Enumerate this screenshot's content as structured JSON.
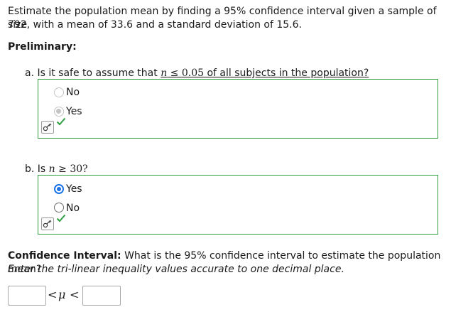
{
  "problem": {
    "statement_line1": "Estimate the population mean by finding a 95% confidence interval given a sample of size",
    "statement_line2": "792, with a mean of 33.6 and a standard deviation of 15.6."
  },
  "preliminary": {
    "heading": "Preliminary:"
  },
  "part_a": {
    "prefix": "a. Is it safe to assume that ",
    "var": "n",
    "op": " ≤ ",
    "value": "0.05",
    "suffix": " of all subjects in the population?",
    "options": [
      "No",
      "Yes"
    ],
    "selected": "Yes",
    "status": "correct"
  },
  "part_b": {
    "prefix": "b. Is ",
    "var": "n",
    "op": " ≥ ",
    "value": "30?",
    "options": [
      "Yes",
      "No"
    ],
    "selected": "Yes",
    "status": "correct"
  },
  "confidence_interval": {
    "label": "Confidence Interval:",
    "question": " What is the 95% confidence interval to estimate the population mean?",
    "instruction": "Enter the tri-linear inequality values accurate to one decimal place.",
    "lt": "<",
    "mu": "μ",
    "lower_value": "",
    "upper_value": ""
  },
  "icons": {
    "key": "key-icon",
    "check": "checkmark-icon",
    "check_color": "#2e9e3f"
  }
}
